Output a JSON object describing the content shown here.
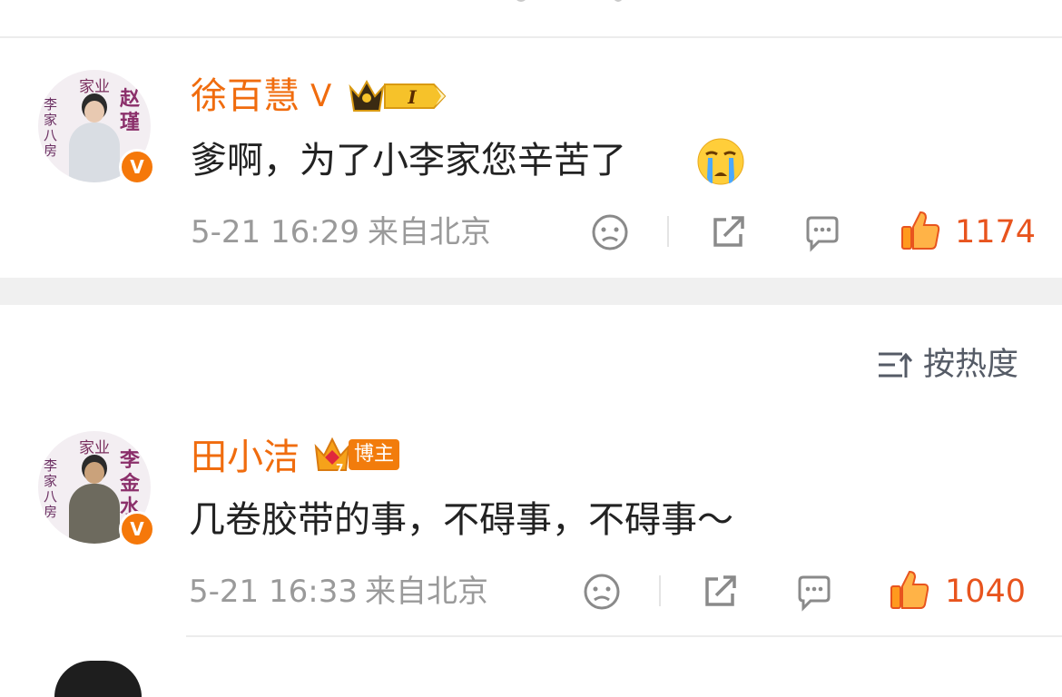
{
  "comments": [
    {
      "username": "徐百慧",
      "verified_mark": "V",
      "level_badge": "I",
      "content": "爹啊，为了小李家您辛苦了",
      "emoji": "crying-face-icon",
      "time": "5-21 16:29",
      "location": "来自北京",
      "likes": "1174",
      "avatar": {
        "title": "家业",
        "left_text": "李家八房",
        "right_text": "赵瑾",
        "badge": "V"
      }
    },
    {
      "username": "田小洁",
      "badge_label": "博主",
      "content": "几卷胶带的事，不碍事，不碍事～",
      "time": "5-21 16:33",
      "location": "来自北京",
      "likes": "1040",
      "avatar": {
        "title": "家业",
        "left_text": "李家八房",
        "right_text": "李金水",
        "badge": "V"
      }
    }
  ],
  "sort": {
    "label": "按热度"
  },
  "colors": {
    "accent": "#f06c0e",
    "like": "#e8541e",
    "meta": "#9a9a9a",
    "badge": "#f5780a"
  }
}
